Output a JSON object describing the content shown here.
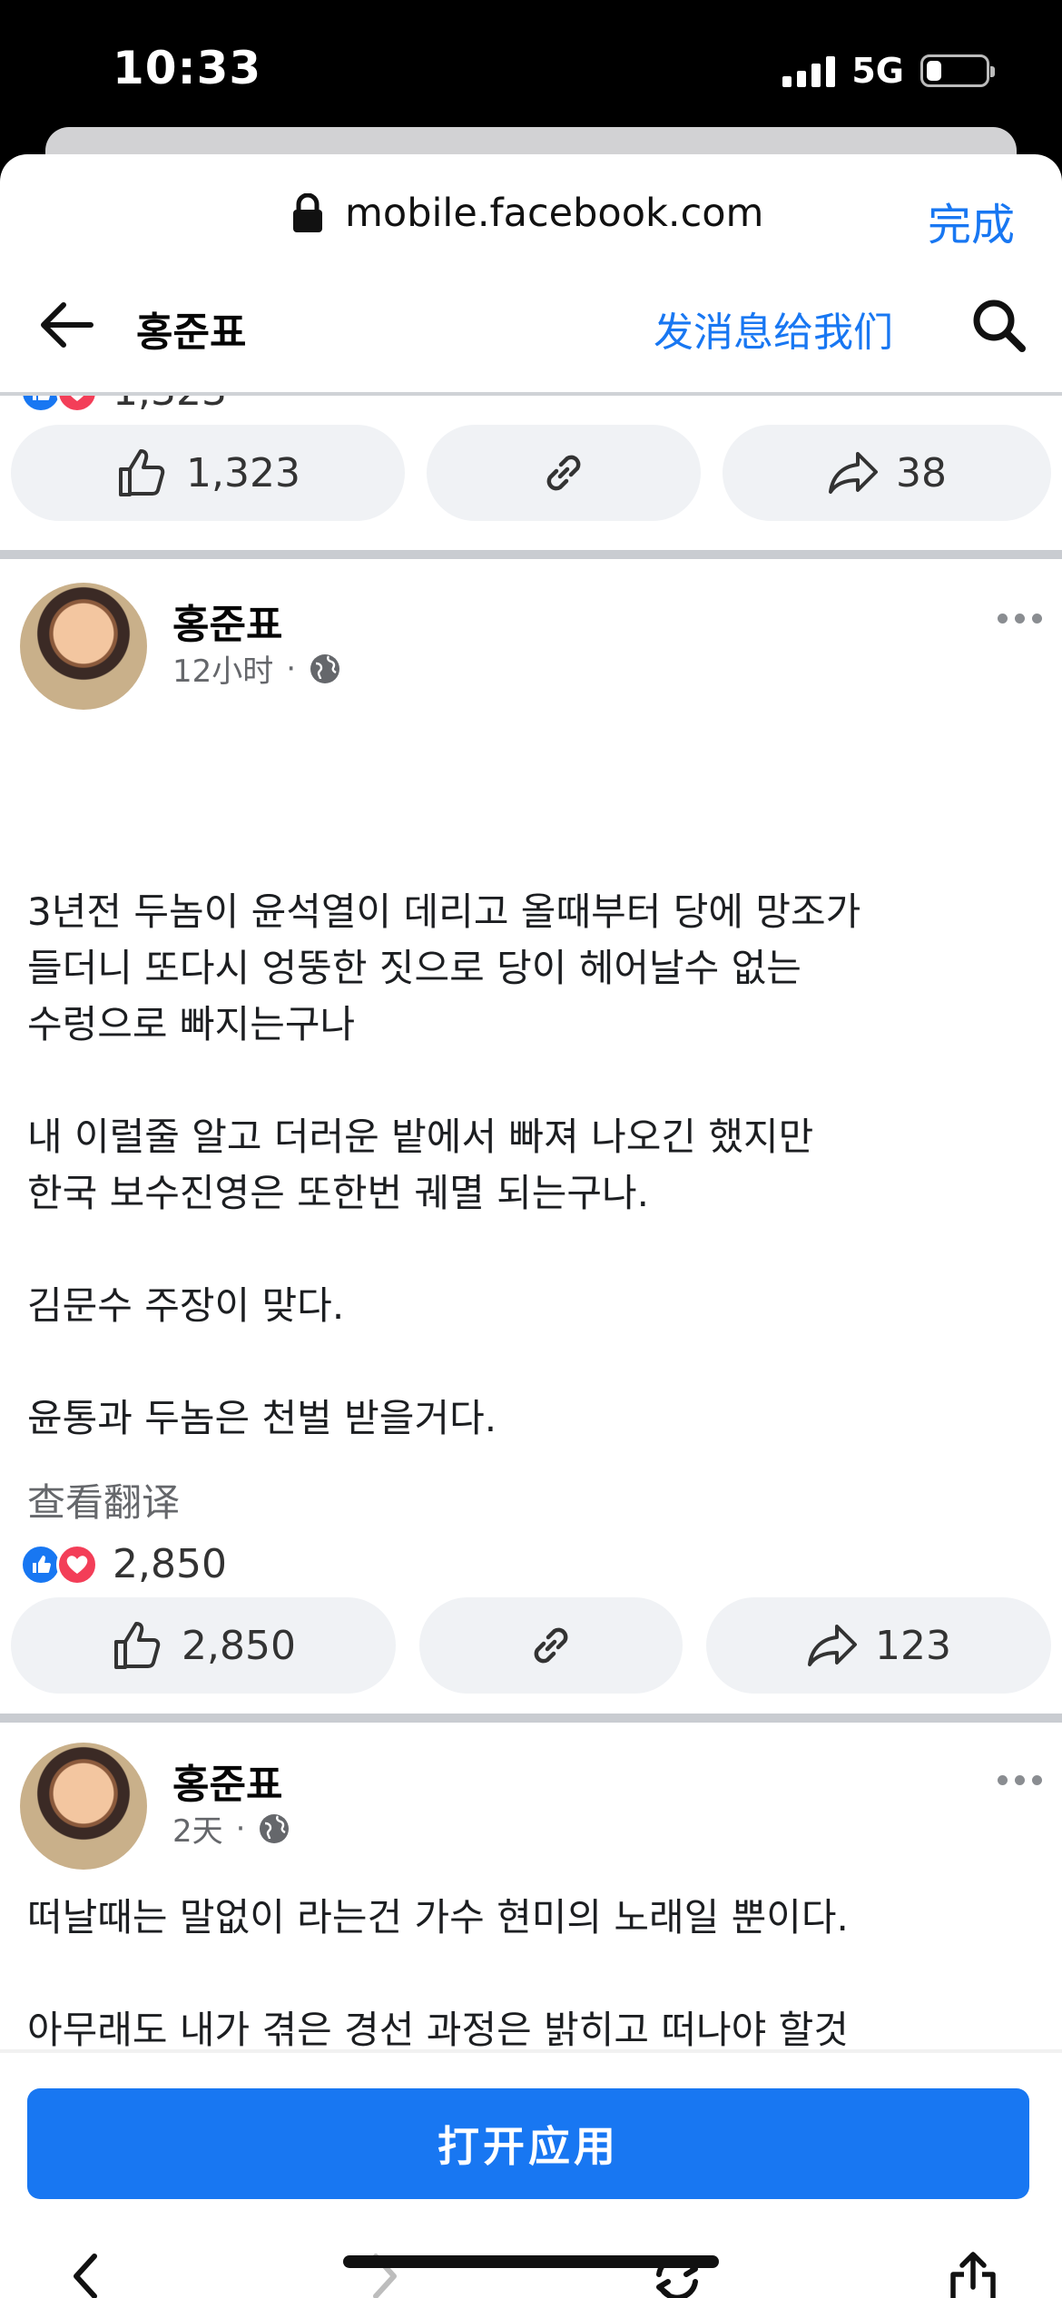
{
  "status": {
    "time": "10:33",
    "network": "5G",
    "battery_level": 0.25
  },
  "browser": {
    "url": "mobile.facebook.com",
    "done_label": "完成"
  },
  "header": {
    "page_name": "홍준표",
    "message_link": "发消息给我们"
  },
  "prev_post": {
    "reaction_count": "1,323",
    "like_count": "1,323",
    "share_count": "38"
  },
  "post1": {
    "author": "홍준표",
    "time": "12小时",
    "lines": [
      "3년전 두놈이 윤석열이 데리고 올때부터 당에 망조가",
      "들더니 또다시 엉뚱한 짓으로 당이 헤어날수 없는",
      "수렁으로 빠지는구나",
      "",
      "내 이럴줄 알고  더러운 밭에서  빠져 나오긴 했지만",
      "한국 보수진영은 또한번 궤멸 되는구나.",
      "",
      "김문수 주장이 맞다.",
      "",
      "윤통과 두놈은 천벌 받을거다."
    ],
    "translate_label": "查看翻译",
    "reaction_count": "2,850",
    "like_count": "2,850",
    "share_count": "123"
  },
  "post2": {
    "author": "홍준표",
    "time": "2天",
    "lines": [
      "떠날때는 말없이 라는건 가수 현미의 노래일 뿐이다.",
      "",
      "아무래도 내가 겪은 경선 과정은 밝히고 떠나야 할것"
    ]
  },
  "open_app_label": "打开应用",
  "colors": {
    "accent": "#1877f2",
    "like_blue": "#1877f2",
    "love_red": "#f33e58"
  }
}
